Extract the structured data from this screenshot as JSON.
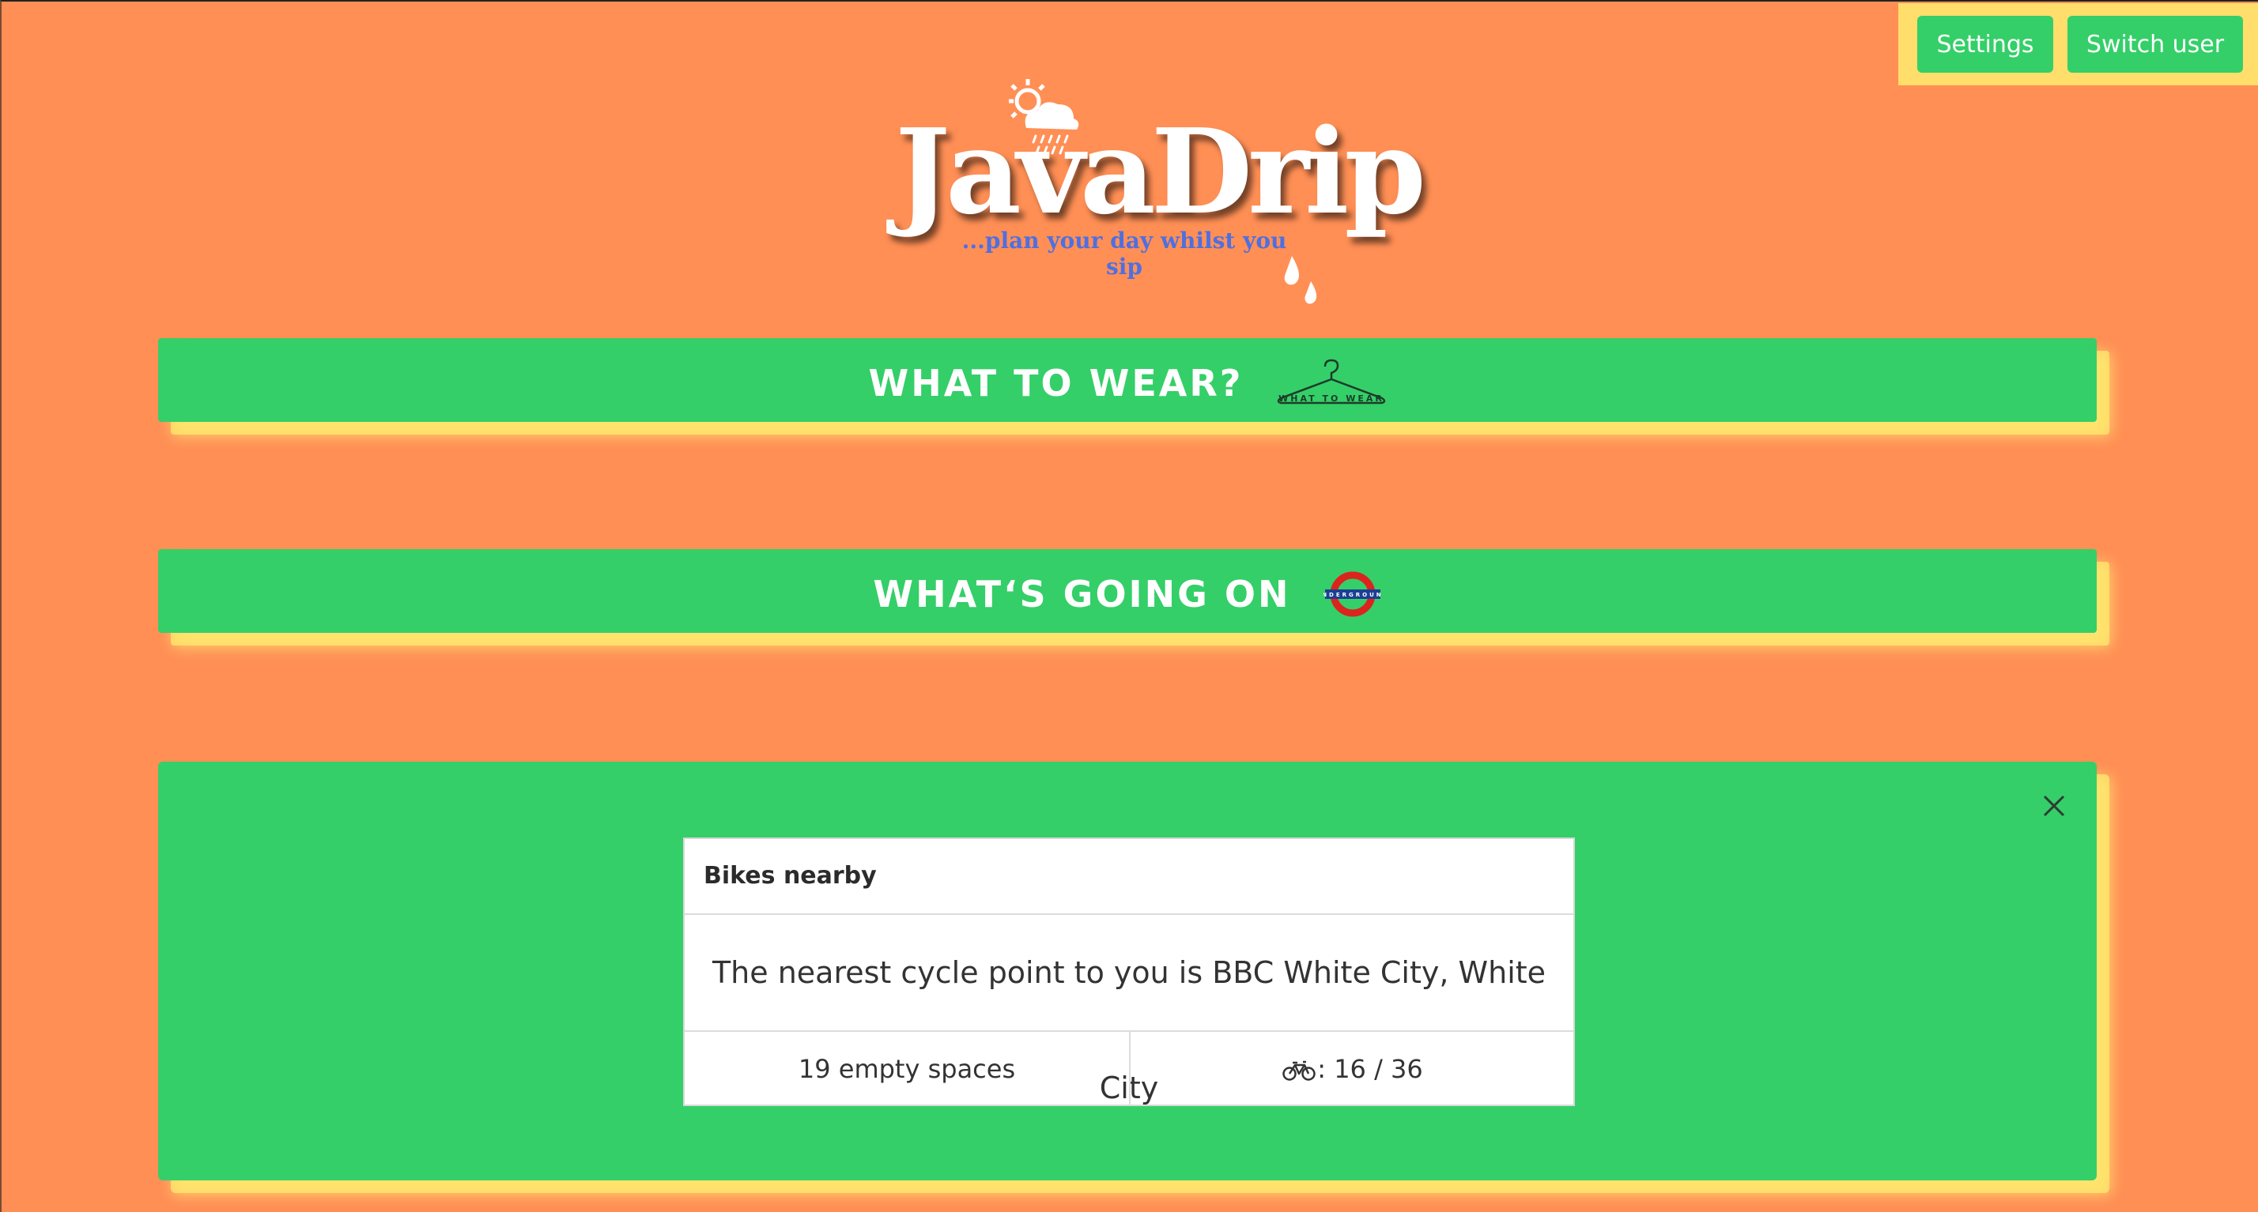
{
  "user_bar": {
    "settings_label": "Settings",
    "switch_user_label": "Switch user",
    "background_color": "#FFDE6B",
    "button_color": "#34CF68"
  },
  "logo": {
    "title": "JavaDrip",
    "tagline": "...plan your day whilst you sip",
    "icons": [
      "sun-cloud-rain-icon",
      "water-drops-icon"
    ]
  },
  "sections": {
    "what_to_wear": {
      "label": "What to wear?",
      "icon": "clothes-hanger-icon",
      "icon_text": "WHAT TO WEAR"
    },
    "whats_going_on": {
      "label": "What‘s going on",
      "icon": "underground-roundel-icon",
      "icon_text": "UNDERGROUND"
    }
  },
  "bikes": {
    "header": "Bikes nearby",
    "body": "The nearest cycle point to you is BBC White City, White City",
    "empty_spaces": "19 empty spaces",
    "bikes_count": ": 16 / 36",
    "bike_icon": "bicycle-icon",
    "close_icon": "close-icon"
  },
  "colors": {
    "page_background": "#FF8F55",
    "panel_green": "#34CF68",
    "shadow_yellow": "#FFE96E",
    "tagline_blue": "#4F6FE0"
  }
}
